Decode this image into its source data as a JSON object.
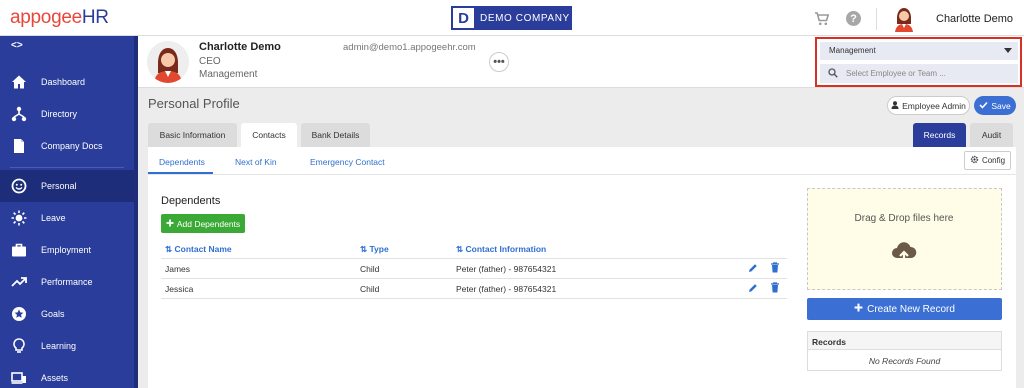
{
  "app": {
    "logo_part1": "appogee",
    "logo_part2": "HR",
    "company_letter": "D",
    "company_name": "DEMO COMPANY",
    "current_user": "Charlotte Demo"
  },
  "sidebar": {
    "toggle": "<>",
    "items": [
      {
        "label": "Dashboard",
        "icon": "home-icon"
      },
      {
        "label": "Directory",
        "icon": "sitemap-icon"
      },
      {
        "label": "Company Docs",
        "icon": "document-icon"
      },
      {
        "label": "Personal",
        "icon": "smile-face-icon"
      },
      {
        "label": "Leave",
        "icon": "sun-icon"
      },
      {
        "label": "Employment",
        "icon": "briefcase-icon"
      },
      {
        "label": "Performance",
        "icon": "trend-line-icon"
      },
      {
        "label": "Goals",
        "icon": "star-badge-icon"
      },
      {
        "label": "Learning",
        "icon": "lightbulb-icon"
      },
      {
        "label": "Assets",
        "icon": "devices-icon"
      }
    ],
    "active_item": "Personal"
  },
  "profile": {
    "name": "Charlotte Demo",
    "title": "CEO",
    "department": "Management",
    "email": "admin@demo1.appogeehr.com",
    "more": "•••"
  },
  "selector": {
    "selected_value": "Management",
    "search_placeholder": "Select Employee or Team ..."
  },
  "page": {
    "title": "Personal Profile",
    "employee_admin_label": "Employee Admin",
    "save_label": "Save"
  },
  "tabs": {
    "left": [
      "Basic Information",
      "Contacts",
      "Bank Details"
    ],
    "active": "Contacts",
    "right": [
      "Records",
      "Audit"
    ],
    "right_active": "Records"
  },
  "subtabs": {
    "items": [
      "Dependents",
      "Next of Kin",
      "Emergency Contact"
    ],
    "active": "Dependents",
    "config_label": "Config"
  },
  "dependents": {
    "heading": "Dependents",
    "add_label": "Add Dependents",
    "columns": [
      "Contact Name",
      "Type",
      "Contact Information"
    ],
    "rows": [
      [
        "James",
        "Child",
        "Peter (father) - 987654321"
      ],
      [
        "Jessica",
        "Child",
        "Peter (father) - 987654321"
      ]
    ]
  },
  "records": {
    "dropzone_text": "Drag & Drop files here",
    "create_label": "Create New Record",
    "panel_title": "Records",
    "empty_text": "No Records Found"
  },
  "colors": {
    "brand_blue": "#2a3d9b",
    "accent_blue": "#3b6fd4",
    "link_blue": "#2f6fd1",
    "green": "#3aa935",
    "highlight_red": "#d93025"
  }
}
